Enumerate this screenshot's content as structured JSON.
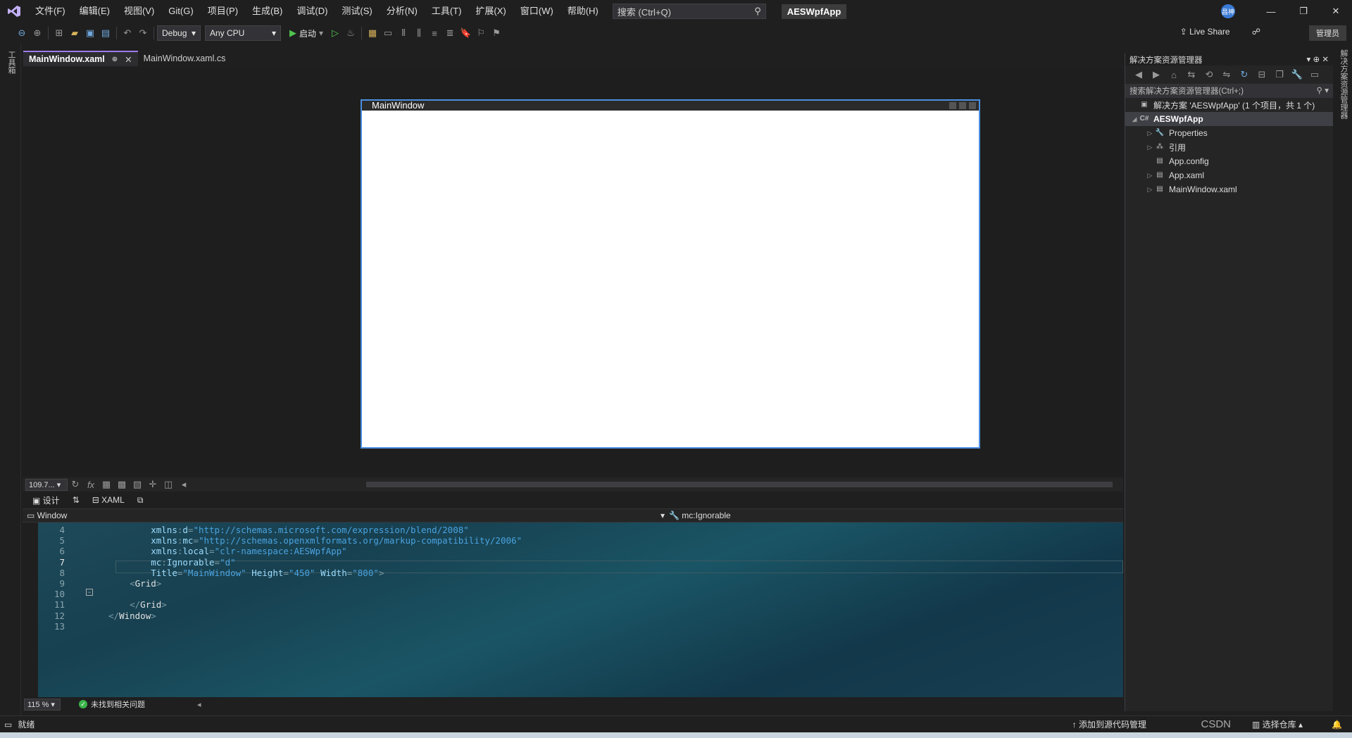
{
  "menubar": {
    "logo": "VS",
    "items": [
      "文件(F)",
      "编辑(E)",
      "视图(V)",
      "Git(G)",
      "项目(P)",
      "生成(B)",
      "调试(D)",
      "测试(S)",
      "分析(N)",
      "工具(T)",
      "扩展(X)",
      "窗口(W)",
      "帮助(H)"
    ],
    "search_placeholder": "搜索 (Ctrl+Q)",
    "solution_name": "AESWpfApp",
    "avatar_text": "昌神"
  },
  "toolbar": {
    "config": "Debug",
    "platform": "Any CPU",
    "start_label": "启动",
    "live_share": "Live Share",
    "admin": "管理员"
  },
  "toolbox_label": "工具箱",
  "doc_tabs": [
    {
      "label": "MainWindow.xaml",
      "active": true
    },
    {
      "label": "MainWindow.xaml.cs",
      "active": false
    }
  ],
  "designer": {
    "window_title": "MainWindow",
    "zoom": "109.7..."
  },
  "split": {
    "design_label": "设计",
    "swap_label": "⇅",
    "xaml_label": "XAML"
  },
  "element_bar": {
    "element": "Window",
    "member": "mc:Ignorable"
  },
  "code_lines": [
    {
      "n": "4",
      "indent": "        ",
      "parts": [
        [
          "attr",
          "xmlns"
        ],
        [
          "punct",
          ":"
        ],
        [
          "attr",
          "d"
        ],
        [
          "punct",
          "="
        ],
        [
          "val",
          "\"http://schemas.microsoft.com/expression/blend/2008\""
        ]
      ]
    },
    {
      "n": "5",
      "indent": "        ",
      "parts": [
        [
          "attr",
          "xmlns"
        ],
        [
          "punct",
          ":"
        ],
        [
          "attr",
          "mc"
        ],
        [
          "punct",
          "="
        ],
        [
          "val",
          "\"http://schemas.openxmlformats.org/markup-compatibility/2006\""
        ]
      ]
    },
    {
      "n": "6",
      "indent": "        ",
      "parts": [
        [
          "attr",
          "xmlns"
        ],
        [
          "punct",
          ":"
        ],
        [
          "attr",
          "local"
        ],
        [
          "punct",
          "="
        ],
        [
          "val",
          "\"clr-namespace:AESWpfApp\""
        ]
      ]
    },
    {
      "n": "7",
      "indent": "        ",
      "parts": [
        [
          "attr",
          "mc"
        ],
        [
          "punct",
          ":"
        ],
        [
          "attr",
          "Ignorable"
        ],
        [
          "punct",
          "="
        ],
        [
          "val",
          "\"d\""
        ]
      ]
    },
    {
      "n": "8",
      "indent": "        ",
      "parts": [
        [
          "attr",
          "Title"
        ],
        [
          "punct",
          "="
        ],
        [
          "val",
          "\"MainWindow\""
        ],
        [
          "attr",
          " Height"
        ],
        [
          "punct",
          "="
        ],
        [
          "val",
          "\"450\""
        ],
        [
          "attr",
          " Width"
        ],
        [
          "punct",
          "="
        ],
        [
          "val",
          "\"800\""
        ],
        [
          "punct",
          ">"
        ]
      ]
    },
    {
      "n": "9",
      "indent": "    ",
      "parts": [
        [
          "punct",
          "<"
        ],
        [
          "tag",
          "Grid"
        ],
        [
          "punct",
          ">"
        ]
      ]
    },
    {
      "n": "10",
      "indent": "",
      "parts": []
    },
    {
      "n": "11",
      "indent": "    ",
      "parts": [
        [
          "punct",
          "</"
        ],
        [
          "tag",
          "Grid"
        ],
        [
          "punct",
          ">"
        ]
      ]
    },
    {
      "n": "12",
      "indent": "",
      "parts": [
        [
          "punct",
          "</"
        ],
        [
          "tag",
          "Window"
        ],
        [
          "punct",
          ">"
        ]
      ]
    },
    {
      "n": "13",
      "indent": "",
      "parts": []
    }
  ],
  "editor_status": {
    "zoom": "115 %",
    "issues": "未找到相关问题"
  },
  "solution_explorer": {
    "title": "解决方案资源管理器",
    "search_placeholder": "搜索解决方案资源管理器(Ctrl+;)",
    "tree": [
      {
        "label": "解决方案 'AESWpfApp' (1 个项目，共 1 个)",
        "level": 0,
        "arrow": "",
        "icon": "▣",
        "selected": false
      },
      {
        "label": "AESWpfApp",
        "level": 0,
        "arrow": "◢",
        "icon": "C#",
        "selected": true
      },
      {
        "label": "Properties",
        "level": 1,
        "arrow": "▷",
        "icon": "🔧",
        "selected": false
      },
      {
        "label": "引用",
        "level": 1,
        "arrow": "▷",
        "icon": "⁂",
        "selected": false
      },
      {
        "label": "App.config",
        "level": 1,
        "arrow": "",
        "icon": "▤",
        "selected": false
      },
      {
        "label": "App.xaml",
        "level": 1,
        "arrow": "▷",
        "icon": "▤",
        "selected": false
      },
      {
        "label": "MainWindow.xaml",
        "level": 1,
        "arrow": "▷",
        "icon": "▤",
        "selected": false
      }
    ]
  },
  "right_strip_label": "解决方案资源管理器",
  "statusbar": {
    "ready": "就绪",
    "add_source": "添加到源代码管理",
    "select_repo": "选择仓库",
    "watermark": "CSDN"
  }
}
